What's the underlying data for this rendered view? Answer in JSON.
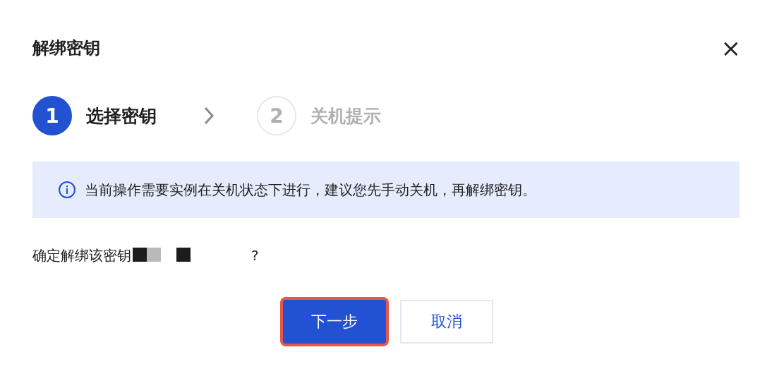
{
  "dialog": {
    "title": "解绑密钥",
    "close_label": "×"
  },
  "steps": [
    {
      "number": "1",
      "label": "选择密钥",
      "selected": true
    },
    {
      "number": "2",
      "label": "关机提示",
      "selected": false
    }
  ],
  "alert": {
    "text": "当前操作需要实例在关机状态下进行，建议您先手动关机，再解绑密钥。"
  },
  "confirm": {
    "prefix": "确定解绑该密钥",
    "suffix": "?"
  },
  "buttons": [
    {
      "label": "下一步",
      "kind": "primary",
      "highlighted": true
    },
    {
      "label": "取消",
      "kind": "secondary",
      "highlighted": false
    }
  ]
}
